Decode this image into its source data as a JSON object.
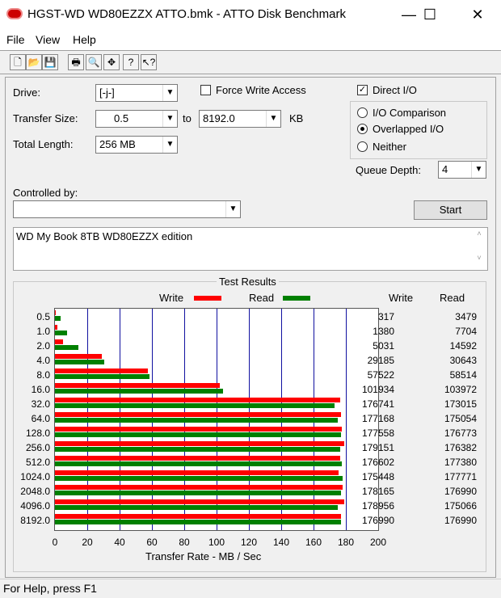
{
  "window": {
    "title": "HGST-WD WD80EZZX ATTO.bmk - ATTO Disk Benchmark",
    "minimize": "—",
    "maximize": "☐",
    "close": "✕"
  },
  "menu": [
    "File",
    "View",
    "Help"
  ],
  "toolbar": [
    {
      "name": "new-icon",
      "glyph": "🗋"
    },
    {
      "name": "open-icon",
      "glyph": "📂"
    },
    {
      "name": "save-icon",
      "glyph": "💾"
    },
    {
      "name": "print-icon",
      "glyph": "🖶"
    },
    {
      "name": "print-preview-icon",
      "glyph": "🔍"
    },
    {
      "name": "move-icon",
      "glyph": "✥"
    },
    {
      "name": "help-icon",
      "glyph": "?"
    },
    {
      "name": "context-help-icon",
      "glyph": "↖?"
    }
  ],
  "form": {
    "drive_label": "Drive:",
    "drive_value": "[-j-]",
    "transfer_size_label": "Transfer Size:",
    "transfer_from": "0.5",
    "to_label": "to",
    "transfer_to": "8192.0",
    "kb_label": "KB",
    "total_length_label": "Total Length:",
    "total_length": "256 MB",
    "force_write": "Force Write Access",
    "force_write_checked": false,
    "direct_io": "Direct I/O",
    "direct_io_checked": true,
    "io_comparison": "I/O Comparison",
    "overlapped_io": "Overlapped I/O",
    "neither": "Neither",
    "selected_mode": "Overlapped I/O",
    "queue_depth_label": "Queue Depth:",
    "queue_depth": "4",
    "controlled_by_label": "Controlled by:",
    "controlled_by": "",
    "start": "Start",
    "description": "WD My Book 8TB WD80EZZX edition"
  },
  "results": {
    "title": "Test Results",
    "legend_write": "Write",
    "legend_read": "Read",
    "col_write": "Write",
    "col_read": "Read",
    "xlabel": "Transfer Rate - MB / Sec",
    "write_color": "#ff0000",
    "read_color": "#008000"
  },
  "chart_data": {
    "type": "bar",
    "title": "Test Results",
    "xlabel": "Transfer Rate - MB / Sec",
    "xlim": [
      0,
      200
    ],
    "xticks": [
      "0",
      "20",
      "40",
      "60",
      "80",
      "100",
      "120",
      "140",
      "160",
      "180",
      "200"
    ],
    "categories": [
      "0.5",
      "1.0",
      "2.0",
      "4.0",
      "8.0",
      "16.0",
      "32.0",
      "64.0",
      "128.0",
      "256.0",
      "512.0",
      "1024.0",
      "2048.0",
      "4096.0",
      "8192.0"
    ],
    "series": [
      {
        "name": "Write",
        "values": [
          317,
          1380,
          5031,
          29185,
          57522,
          101934,
          176741,
          177168,
          177558,
          179151,
          176602,
          175448,
          178165,
          178956,
          176990
        ]
      },
      {
        "name": "Read",
        "values": [
          3479,
          7704,
          14592,
          30643,
          58514,
          103972,
          173015,
          175054,
          176773,
          176382,
          177380,
          177771,
          176990,
          175066,
          176990
        ]
      }
    ]
  },
  "status": "For Help, press F1"
}
